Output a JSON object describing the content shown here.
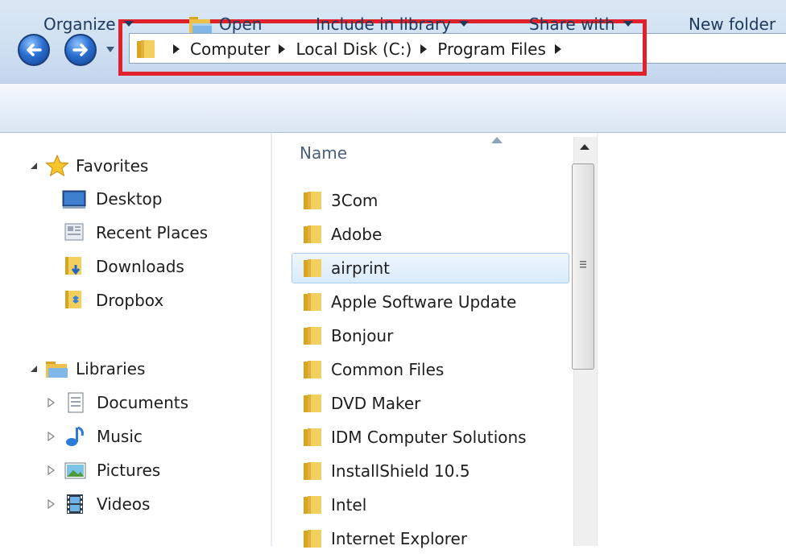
{
  "window": {
    "breadcrumb": [
      "Computer",
      "Local Disk (C:)",
      "Program Files"
    ],
    "colors": {
      "highlight": "#e0202a",
      "selection": "#d9ebfb",
      "toolbar_text": "#1e395b"
    }
  },
  "toolbar": {
    "organize_label": "Organize",
    "open_label": "Open",
    "include_label": "Include in library",
    "share_label": "Share with",
    "new_folder_label": "New folder"
  },
  "navpane": {
    "favorites": {
      "label": "Favorites",
      "items": [
        "Desktop",
        "Recent Places",
        "Downloads",
        "Dropbox"
      ]
    },
    "libraries": {
      "label": "Libraries",
      "items": [
        "Documents",
        "Music",
        "Pictures",
        "Videos"
      ]
    }
  },
  "filelist": {
    "column_name": "Name",
    "selected": "airprint",
    "items": [
      "3Com",
      "Adobe",
      "airprint",
      "Apple Software Update",
      "Bonjour",
      "Common Files",
      "DVD Maker",
      "IDM Computer Solutions",
      "InstallShield 10.5",
      "Intel",
      "Internet Explorer"
    ]
  },
  "icons": {
    "back": "back-arrow-icon",
    "forward": "forward-arrow-icon",
    "folder": "folder-icon",
    "star": "star-icon",
    "desktop": "desktop-icon",
    "recent": "recent-places-icon",
    "downloads": "downloads-folder-icon",
    "dropbox": "dropbox-folder-icon",
    "libraries": "libraries-icon",
    "documents": "documents-icon",
    "music": "music-note-icon",
    "pictures": "pictures-icon",
    "videos": "film-icon"
  }
}
